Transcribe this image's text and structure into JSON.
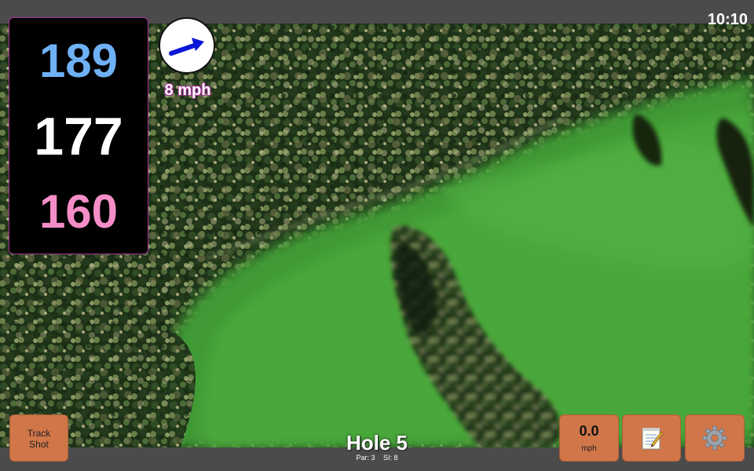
{
  "status_bar": {
    "time": "10:10"
  },
  "distances": {
    "back": "189",
    "middle": "177",
    "front": "160",
    "colors": {
      "back": "#6fb1f5",
      "middle": "#ffffff",
      "front": "#f58ec8",
      "panel_border": "#a9339b"
    }
  },
  "wind": {
    "speed_text": "8 mph",
    "direction_icon": "arrow-right-up-icon",
    "arrow_color": "#0a16d8"
  },
  "hole": {
    "title": "Hole 5",
    "par": "Par: 3",
    "stroke_index": "SI: 8"
  },
  "buttons": {
    "track_shot": {
      "line1": "Track",
      "line2": "Shot"
    },
    "speed": {
      "value": "0.0",
      "unit": "mph"
    },
    "notes": {
      "icon": "notepad-icon"
    },
    "settings": {
      "icon": "gear-icon"
    },
    "color": "#d07649"
  }
}
